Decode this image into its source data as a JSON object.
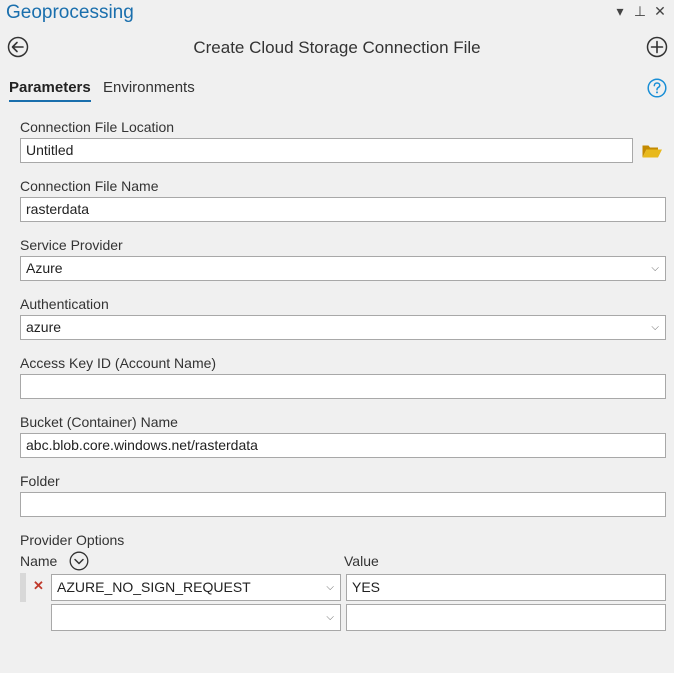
{
  "pane": {
    "title": "Geoprocessing",
    "menu_glyph": "▾",
    "pin_glyph": "⊥",
    "close_glyph": "✕"
  },
  "tool": {
    "title": "Create Cloud Storage Connection File"
  },
  "tabs": [
    {
      "label": "Parameters",
      "active": true
    },
    {
      "label": "Environments",
      "active": false
    }
  ],
  "params": {
    "location": {
      "label": "Connection File Location",
      "value": "Untitled"
    },
    "name": {
      "label": "Connection File Name",
      "value": "rasterdata"
    },
    "provider": {
      "label": "Service Provider",
      "value": "Azure"
    },
    "auth": {
      "label": "Authentication",
      "value": "azure"
    },
    "access_key": {
      "label": "Access Key ID (Account Name)",
      "value": ""
    },
    "bucket": {
      "label": "Bucket (Container) Name",
      "value": "abc.blob.core.windows.net/rasterdata"
    },
    "folder": {
      "label": "Folder",
      "value": ""
    }
  },
  "provider_options": {
    "label": "Provider Options",
    "col_name": "Name",
    "col_value": "Value",
    "rows": [
      {
        "name": "AZURE_NO_SIGN_REQUEST",
        "value": "YES"
      },
      {
        "name": "",
        "value": ""
      }
    ]
  },
  "colors": {
    "accent": "#1a6fad",
    "folder": "#d9a400",
    "delete": "#c0392b"
  }
}
